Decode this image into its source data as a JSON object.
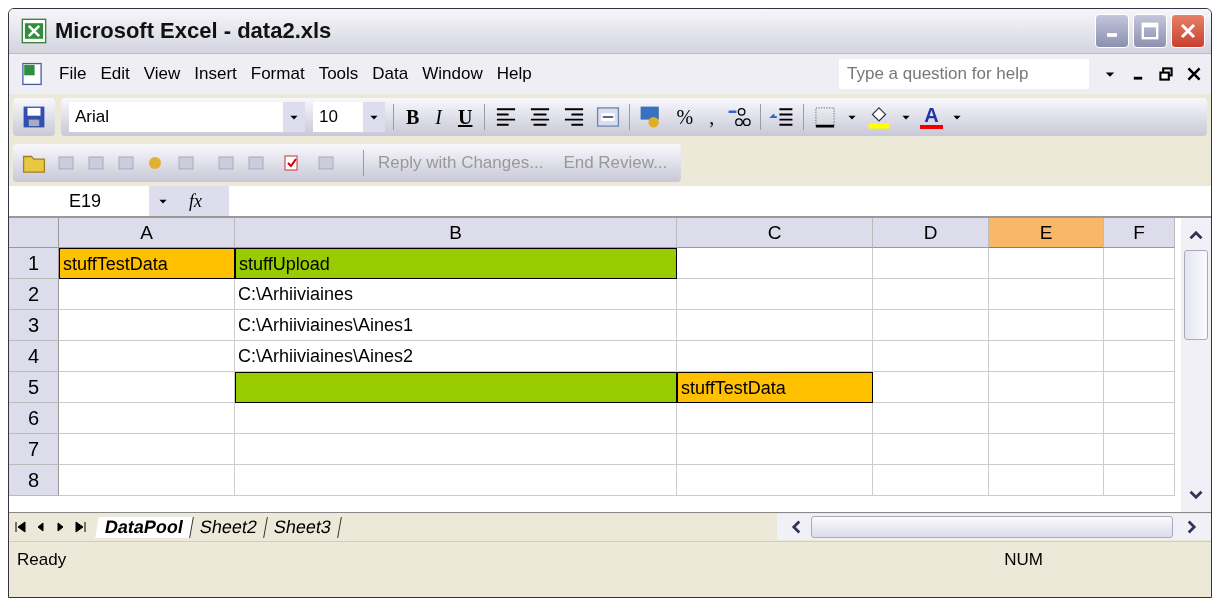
{
  "window": {
    "title": "Microsoft Excel - data2.xls"
  },
  "menu": [
    "File",
    "Edit",
    "View",
    "Insert",
    "Format",
    "Tools",
    "Data",
    "Window",
    "Help"
  ],
  "help_box": {
    "placeholder": "Type a question for help"
  },
  "formatting_toolbar": {
    "font": "Arial",
    "size": "10",
    "bold": "B",
    "italic": "I",
    "underline": "U",
    "percent": "%",
    "comma": ",",
    "font_color": "A"
  },
  "reviewing_toolbar": {
    "buttons": [
      "Reply with Changes...",
      "End Review..."
    ]
  },
  "formula_bar": {
    "name_box": "E19",
    "fx": "fx"
  },
  "columns": [
    {
      "label": "A",
      "selected": false
    },
    {
      "label": "B",
      "selected": false
    },
    {
      "label": "C",
      "selected": false
    },
    {
      "label": "D",
      "selected": false
    },
    {
      "label": "E",
      "selected": true
    },
    {
      "label": "F",
      "selected": false
    }
  ],
  "rows": [
    {
      "header": "1",
      "cells": [
        {
          "text": "stuffTestData",
          "color": "#ffc000"
        },
        {
          "text": "stuffUpload",
          "color": "#99cc00"
        },
        {},
        {},
        {},
        {}
      ]
    },
    {
      "header": "2",
      "cells": [
        {},
        {
          "text": "C:\\Arhiiviaines"
        },
        {},
        {},
        {},
        {}
      ]
    },
    {
      "header": "3",
      "cells": [
        {},
        {
          "text": "C:\\Arhiiviaines\\Aines1"
        },
        {},
        {},
        {},
        {}
      ]
    },
    {
      "header": "4",
      "cells": [
        {},
        {
          "text": "C:\\Arhiiviaines\\Aines2"
        },
        {},
        {},
        {},
        {}
      ]
    },
    {
      "header": "5",
      "cells": [
        {},
        {
          "color": "#99cc00"
        },
        {
          "text": "stuffTestData",
          "color": "#ffc000"
        },
        {},
        {},
        {}
      ]
    },
    {
      "header": "6",
      "cells": [
        {},
        {},
        {},
        {},
        {},
        {}
      ]
    },
    {
      "header": "7",
      "cells": [
        {},
        {},
        {},
        {},
        {},
        {}
      ]
    },
    {
      "header": "8",
      "cells": [
        {},
        {},
        {},
        {},
        {},
        {}
      ]
    }
  ],
  "sheet_tabs": [
    {
      "label": "DataPool",
      "selected": true
    },
    {
      "label": "Sheet2",
      "selected": false
    },
    {
      "label": "Sheet3",
      "selected": false
    }
  ],
  "status_bar": {
    "status": "Ready",
    "num": "NUM"
  }
}
